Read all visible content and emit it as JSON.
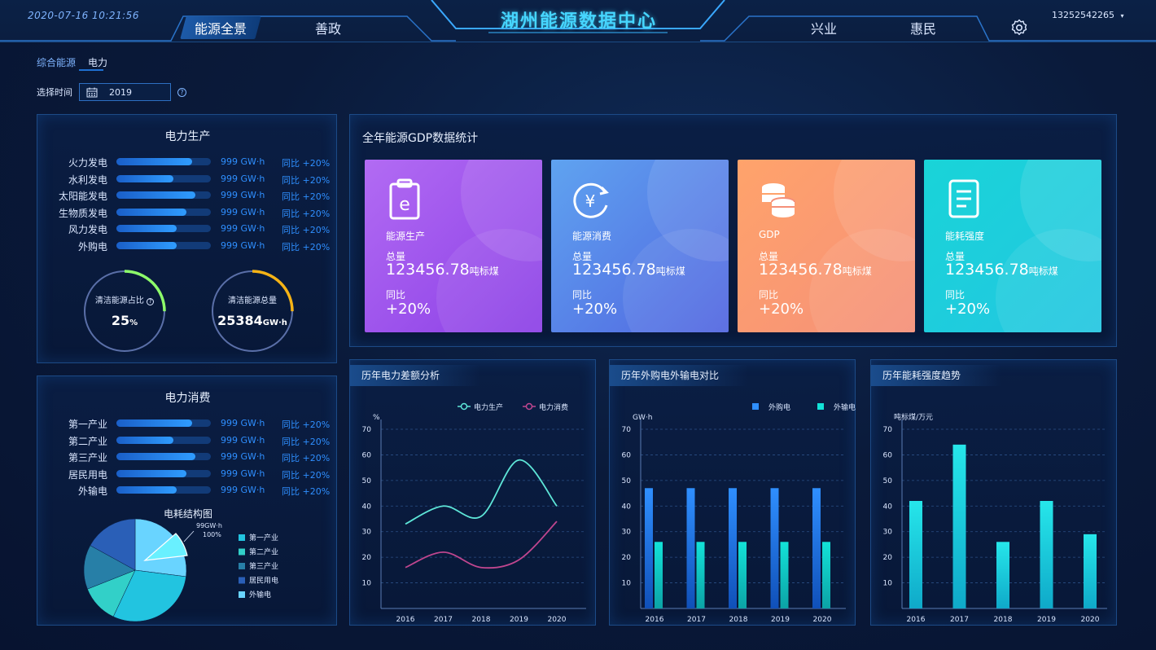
{
  "header": {
    "datetime": "2020-07-16 10:21:56",
    "title": "湖州能源数据中心",
    "nav_left": [
      {
        "label": "能源全景",
        "active": true
      },
      {
        "label": "善政",
        "active": false
      }
    ],
    "nav_right": [
      {
        "label": "兴业"
      },
      {
        "label": "惠民"
      }
    ],
    "user": "13252542265",
    "icons": {
      "settings": "gear-icon",
      "user_menu": "chevron-down-icon"
    }
  },
  "subtabs": [
    {
      "label": "综合能源",
      "active": false
    },
    {
      "label": "电力",
      "active": true
    }
  ],
  "time_filter": {
    "label": "选择时间",
    "value": "2019",
    "icon": "calendar-icon"
  },
  "power_production": {
    "title": "电力生产",
    "items": [
      {
        "label": "火力发电",
        "value": "999 GW·h",
        "yoy": "同比 +20%",
        "fill": 0.8
      },
      {
        "label": "水利发电",
        "value": "999 GW·h",
        "yoy": "同比 +20%",
        "fill": 0.6
      },
      {
        "label": "太阳能发电",
        "value": "999 GW·h",
        "yoy": "同比 +20%",
        "fill": 0.84
      },
      {
        "label": "生物质发电",
        "value": "999 GW·h",
        "yoy": "同比 +20%",
        "fill": 0.74
      },
      {
        "label": "风力发电",
        "value": "999 GW·h",
        "yoy": "同比 +20%",
        "fill": 0.64
      },
      {
        "label": "外购电",
        "value": "999 GW·h",
        "yoy": "同比 +20%",
        "fill": 0.64
      }
    ],
    "gauges": [
      {
        "label": "清洁能源占比",
        "value": "25",
        "unit": "%",
        "fraction": 0.25,
        "color": "#8dfc6a"
      },
      {
        "label": "清洁能源总量",
        "value": "25384",
        "unit": "GW·h",
        "fraction": 0.25,
        "color": "#f5b316"
      }
    ]
  },
  "power_consumption": {
    "title": "电力消费",
    "items": [
      {
        "label": "第一产业",
        "value": "999 GW·h",
        "yoy": "同比 +20%",
        "fill": 0.8
      },
      {
        "label": "第二产业",
        "value": "999 GW·h",
        "yoy": "同比 +20%",
        "fill": 0.6
      },
      {
        "label": "第三产业",
        "value": "999 GW·h",
        "yoy": "同比 +20%",
        "fill": 0.84
      },
      {
        "label": "居民用电",
        "value": "999 GW·h",
        "yoy": "同比 +20%",
        "fill": 0.74
      },
      {
        "label": "外输电",
        "value": "999 GW·h",
        "yoy": "同比 +20%",
        "fill": 0.64
      }
    ]
  },
  "gdp_stats": {
    "title": "全年能源GDP数据统计",
    "total_label": "总量",
    "yoy_label": "同比",
    "cards": [
      {
        "name": "能源生产",
        "total": "123456.78",
        "unit": "吨标煤",
        "yoy": "+20%",
        "icon": "clipboard-e-icon",
        "grad": "linear-gradient(135deg,#b26bf3 0%,#8b3fe6 100%)"
      },
      {
        "name": "能源消费",
        "total": "123456.78",
        "unit": "吨标煤",
        "yoy": "+20%",
        "icon": "yen-refresh-icon",
        "grad": "linear-gradient(135deg,#5fa3f0 0%,#5165e0 100%)"
      },
      {
        "name": "GDP",
        "total": "123456.78",
        "unit": "吨标煤",
        "yoy": "+20%",
        "icon": "coins-icon",
        "grad": "linear-gradient(135deg,#ffa36b 0%,#f59079 100%)"
      },
      {
        "name": "能耗强度",
        "total": "123456.78",
        "unit": "吨标煤",
        "yoy": "+20%",
        "icon": "document-icon",
        "grad": "linear-gradient(135deg,#19d4d8 0%,#23c6e1 100%)"
      }
    ]
  },
  "chart_data": [
    {
      "type": "line",
      "title": "历年电力差额分析",
      "ylabel": "%",
      "x": [
        "2016",
        "2017",
        "2018",
        "2019",
        "2020"
      ],
      "ylim": [
        0,
        70
      ],
      "yticks": [
        "10",
        "20",
        "30",
        "40",
        "50",
        "60",
        "70"
      ],
      "series": [
        {
          "name": "电力生产",
          "values": [
            33,
            40,
            36,
            58,
            40
          ],
          "color": "#5ee6d8"
        },
        {
          "name": "电力消费",
          "values": [
            16,
            22,
            16,
            19,
            34
          ],
          "color": "#c0468f"
        }
      ],
      "legend": "top-right"
    },
    {
      "type": "bar",
      "title": "历年外购电外输电对比",
      "ylabel": "GW·h",
      "categories": [
        "2016",
        "2017",
        "2018",
        "2019",
        "2020"
      ],
      "ylim": [
        0,
        70
      ],
      "yticks": [
        "10",
        "20",
        "30",
        "40",
        "50",
        "60",
        "70"
      ],
      "series": [
        {
          "name": "外购电",
          "values": [
            47,
            47,
            47,
            47,
            47
          ],
          "color": "#2f8fff"
        },
        {
          "name": "外输电",
          "values": [
            26,
            26,
            26,
            26,
            26
          ],
          "color": "#13e2d8"
        }
      ],
      "legend": "top-right"
    },
    {
      "type": "bar",
      "title": "历年能耗强度趋势",
      "ylabel": "吨标煤/万元",
      "categories": [
        "2016",
        "2017",
        "2018",
        "2019",
        "2020"
      ],
      "ylim": [
        0,
        70
      ],
      "yticks": [
        "10",
        "20",
        "30",
        "40",
        "50",
        "60",
        "70"
      ],
      "series": [
        {
          "values": [
            42,
            64,
            26,
            42,
            29
          ],
          "color": "#1cd3e6"
        }
      ]
    },
    {
      "type": "pie",
      "title": "电耗结构图",
      "labels": [
        "第一产业",
        "第二产业",
        "第三产业",
        "居民用电",
        "外输电"
      ],
      "values": [
        30,
        12,
        14,
        17,
        27
      ],
      "colors": [
        "#22c4e0",
        "#32d0c8",
        "#277fa7",
        "#2a5fb7",
        "#69d4ff"
      ],
      "highlight": {
        "label": "99GW·h",
        "percent": "100%"
      }
    }
  ]
}
